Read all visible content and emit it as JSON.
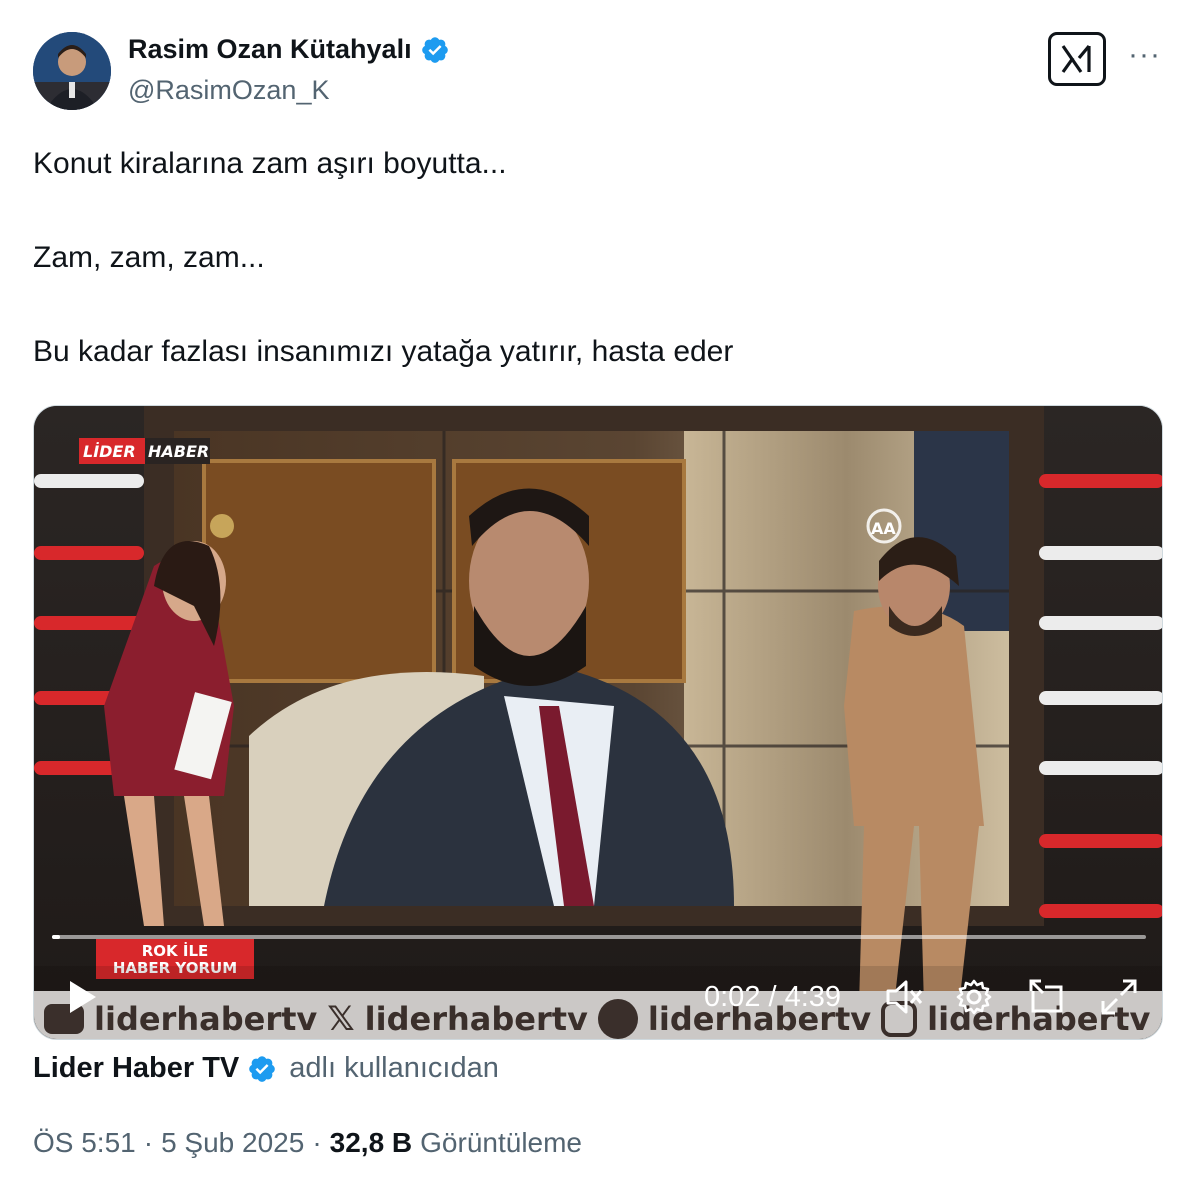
{
  "author": {
    "name": "Rasim Ozan Kütahyalı",
    "handle": "@RasimOzan_K",
    "verified_color": "#1d9bf0"
  },
  "header_icons": {
    "grok": "grok-icon",
    "more": "more-icon",
    "more_glyph": "···"
  },
  "tweet": {
    "line1": "Konut kiralarına zam aşırı boyutta...",
    "line2": "Zam, zam, zam...",
    "line3": "Bu kadar fazlası insanımızı yatağa yatırır, hasta eder"
  },
  "video": {
    "channel_logo_left": "LİDER",
    "channel_logo_right": "HABER",
    "lower_third_line1": "ROK İLE",
    "lower_third_line2": "HABER YORUM",
    "watermark_aa": "AA",
    "social_handle": "liderhabertv",
    "time": "0:02 / 4:39",
    "progress_fraction": 0.007,
    "controls": [
      "play-icon",
      "mute-icon",
      "settings-icon",
      "pip-icon",
      "fullscreen-icon"
    ]
  },
  "source": {
    "name": "Lider Haber TV",
    "suffix": "adlı kullanıcıdan"
  },
  "meta": {
    "time": "ÖS 5:51",
    "sep1": "·",
    "date": "5 Şub 2025",
    "sep2": "·",
    "views": "32,8 B",
    "views_label": "Görüntüleme"
  }
}
